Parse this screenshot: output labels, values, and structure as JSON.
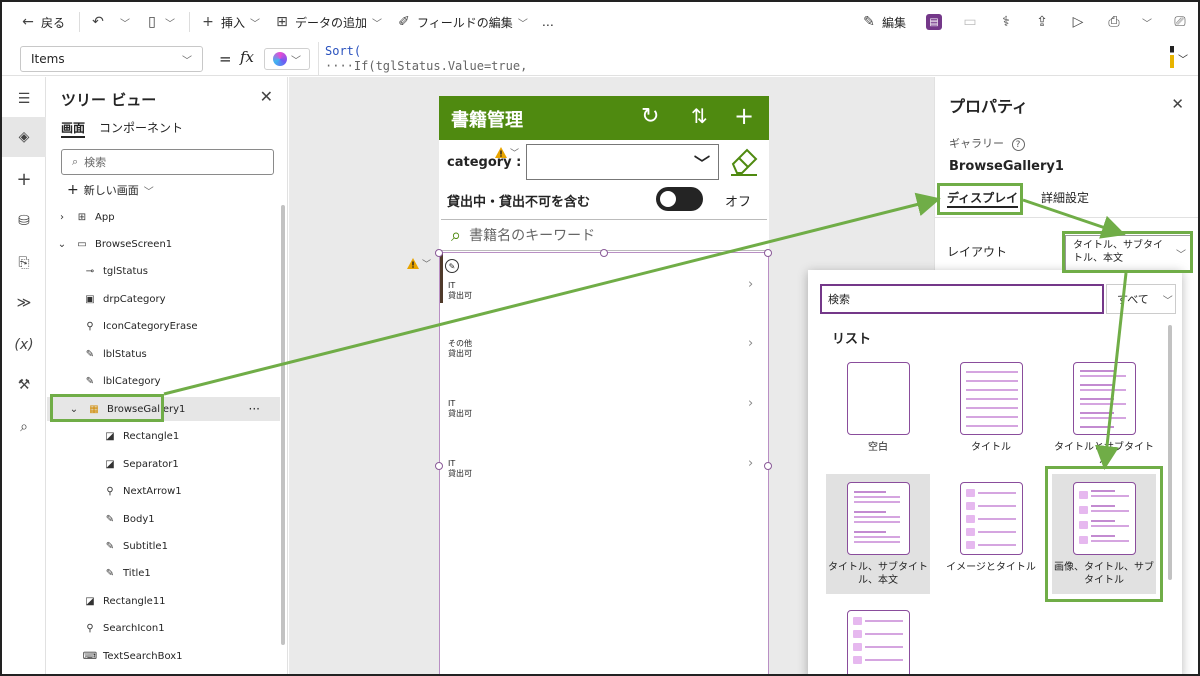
{
  "toolbar": {
    "back": "戻る",
    "insert": "挿入",
    "add_data": "データの追加",
    "edit_fields": "フィールドの編集",
    "more": "…",
    "edit": "編集"
  },
  "formula_bar": {
    "property": "Items",
    "eq": "=",
    "fx": "fx",
    "line1": "Sort(",
    "line2": "····If(tglStatus.Value=true,"
  },
  "tree": {
    "title": "ツリー ビュー",
    "tab_screens": "画面",
    "tab_components": "コンポーネント",
    "search_placeholder": "検索",
    "new_screen": "新しい画面",
    "nodes": [
      {
        "label": "App"
      },
      {
        "label": "BrowseScreen1"
      },
      {
        "label": "tglStatus"
      },
      {
        "label": "drpCategory"
      },
      {
        "label": "IconCategoryErase"
      },
      {
        "label": "lblStatus"
      },
      {
        "label": "lblCategory"
      },
      {
        "label": "BrowseGallery1"
      },
      {
        "label": "Rectangle1"
      },
      {
        "label": "Separator1"
      },
      {
        "label": "NextArrow1"
      },
      {
        "label": "Body1"
      },
      {
        "label": "Subtitle1"
      },
      {
        "label": "Title1"
      },
      {
        "label": "Rectangle11"
      },
      {
        "label": "SearchIcon1"
      },
      {
        "label": "TextSearchBox1"
      }
    ],
    "more": "···"
  },
  "app": {
    "title": "書籍管理",
    "category_label": "category :",
    "status_label": "貸出中・貸出不可を含む",
    "toggle_text": "オフ",
    "search_placeholder": "書籍名のキーワード",
    "items": [
      {
        "title": "IT",
        "subtitle": "貸出可"
      },
      {
        "title": "その他",
        "subtitle": "貸出可"
      },
      {
        "title": "IT",
        "subtitle": "貸出可"
      },
      {
        "title": "IT",
        "subtitle": "貸出可"
      }
    ]
  },
  "props": {
    "title": "プロパティ",
    "type": "ギャラリー",
    "name": "BrowseGallery1",
    "tab_display": "ディスプレイ",
    "tab_advanced": "詳細設定",
    "layout_label": "レイアウト",
    "layout_value": "タイトル、サブタイトル、本文"
  },
  "flyout": {
    "search_placeholder": "検索",
    "filter": "すべて",
    "heading": "リスト",
    "tiles": [
      {
        "label": "空白"
      },
      {
        "label": "タイトル"
      },
      {
        "label": "タイトルとサブタイトル"
      },
      {
        "label": "タイトル、サブタイトル、本文"
      },
      {
        "label": "イメージとタイトル"
      },
      {
        "label": "画像、タイトル、サブタイトル"
      }
    ]
  },
  "colors": {
    "accent": "#743889",
    "app_header": "#4f8a10",
    "annotation": "#70ad47"
  }
}
